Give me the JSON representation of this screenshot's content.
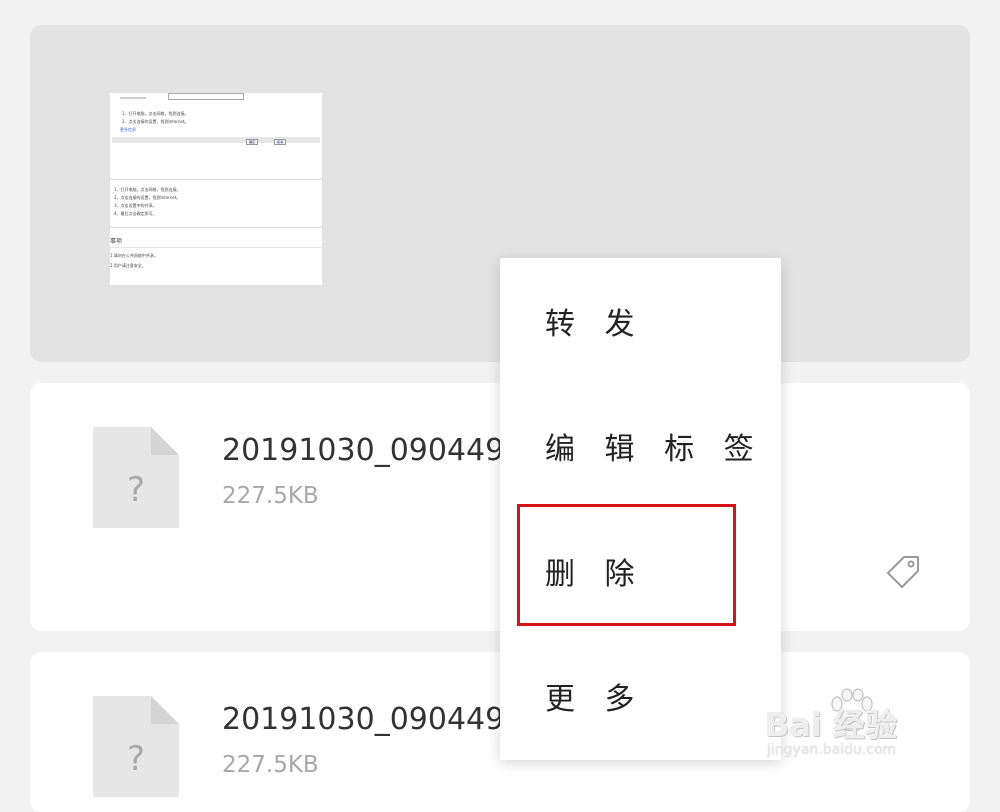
{
  "files": [
    {
      "name": "20191030_090449.",
      "size": "227.5KB",
      "icon_glyph": "?",
      "icon": "unknown-file-icon"
    },
    {
      "name": "20191030_090449.",
      "size": "227.5KB",
      "icon_glyph": "?",
      "icon": "unknown-file-icon"
    }
  ],
  "image_preview": {
    "lines": [
      "1、打开电脑，点击网络，找到连接。",
      "2、点击连接的设置，找到Internet。",
      "3、点击设置中的共享。",
      "4、最后点击确定即可。"
    ],
    "heading": "事项",
    "notes": [
      "1.请勿在公共网络中共享。",
      "2.用户请注意安全。"
    ],
    "buttons": [
      "确定",
      "取消"
    ],
    "link": "更多信息"
  },
  "context_menu": {
    "items": [
      {
        "label": "转 发"
      },
      {
        "label": "编 辑 标 签"
      },
      {
        "label": "删 除"
      },
      {
        "label": "更 多"
      }
    ],
    "highlighted_index": 2
  },
  "colors": {
    "highlight": "#d51217",
    "background": "#f2f2f2",
    "card": "#ffffff",
    "image_card": "#e3e3e3"
  },
  "watermark": {
    "brand": "Bai 经验",
    "url": "jingyan.baidu.com"
  }
}
